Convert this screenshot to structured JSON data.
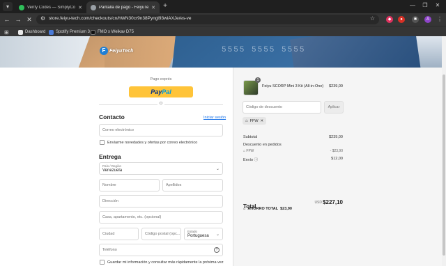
{
  "browser": {
    "tabs": [
      {
        "title": "Verify Codes — SimplyCodes",
        "active": false
      },
      {
        "title": "Pantalla de pago - FeiyuTech",
        "active": true
      }
    ],
    "new_tab": "+",
    "url": "store.feiyu-tech.com/checkouts/cn/hWN30cr9n38Pyngl93wiAXJe/es-ve",
    "profile_initial": "A",
    "bookmarks": [
      "Dashboard",
      "Spotify Premium 3",
      "FMO x Weikav D75"
    ]
  },
  "banner": {
    "brand": "FeiyuTech",
    "card_digits": "5555  5555  5555"
  },
  "checkout": {
    "express_label": "Pago exprés",
    "paypal_pay": "Pay",
    "paypal_pal": "Pal",
    "or_label": "O",
    "contact": {
      "heading": "Contacto",
      "login_link": "Iniciar sesión",
      "email_placeholder": "Correo electrónico",
      "newsletter_label": "Envíarme novedades y ofertas por correo electrónico"
    },
    "delivery": {
      "heading": "Entrega",
      "country_label": "País / Región",
      "country_value": "Venezuela",
      "first_name": "Nombre",
      "last_name": "Apellidos",
      "address": "Dirección",
      "apartment": "Casa, apartamento, etc. (opcional)",
      "city": "Ciudad",
      "postal": "Código postal (opc...",
      "state_label": "Estado",
      "state_value": "Portuguesa",
      "phone": "Teléfono",
      "save_label": "Guardar mi información y consultar más rápidamente la próxima vez"
    }
  },
  "summary": {
    "product_name": "Feiyu SCORP Mini 3 Kit (All-in-One)",
    "product_qty": "1",
    "product_price": "$239,00",
    "discount_placeholder": "Código de descuento",
    "apply_label": "Aplicar",
    "chip_code": "FFW",
    "subtotal_label": "Subtotal",
    "subtotal_value": "$239,00",
    "order_discount_label": "Descuento en pedidos",
    "discount_code": "FFW",
    "discount_value": "- $23,90",
    "shipping_label": "Envío",
    "shipping_value": "$12,00",
    "total_label": "Total",
    "currency": "USD",
    "total_value": "$227,10",
    "saving_label": "AHORRO TOTAL",
    "saving_value": "$23,90"
  },
  "colors": {
    "paypal_yellow": "#ffc439",
    "link_blue": "#1a73e8"
  }
}
